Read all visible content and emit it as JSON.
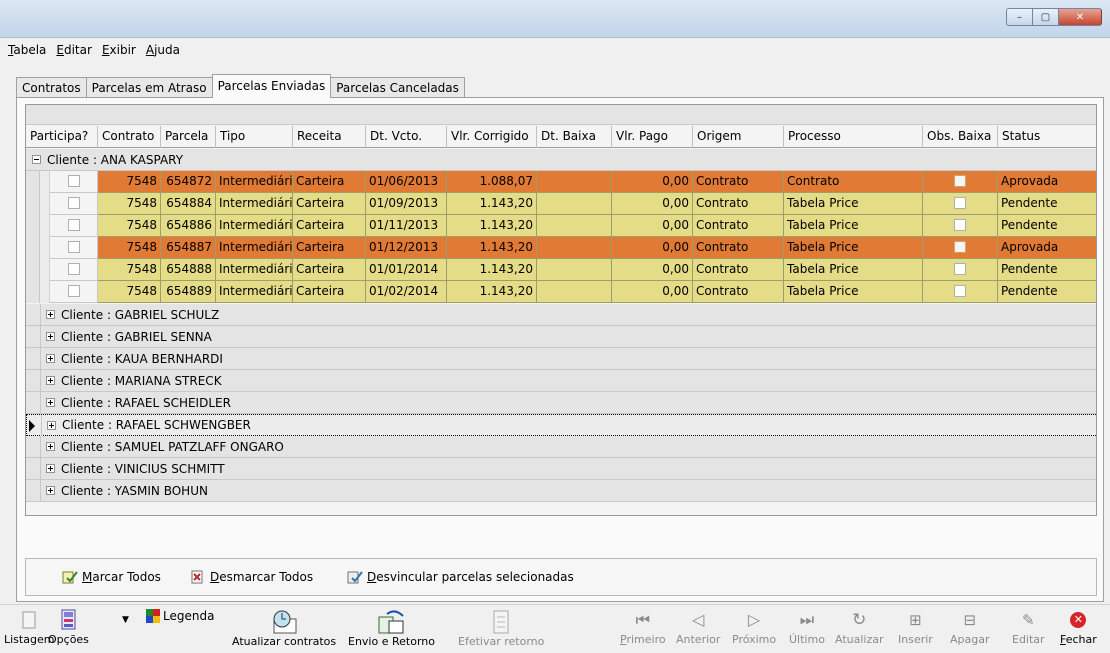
{
  "window": {
    "buttons": {
      "minimize": "–",
      "maximize": "▢",
      "close": "✕"
    }
  },
  "menu": [
    "Tabela",
    "Editar",
    "Exibir",
    "Ajuda"
  ],
  "tabs": [
    "Contratos",
    "Parcelas em Atraso",
    "Parcelas Enviadas",
    "Parcelas Canceladas"
  ],
  "active_tab": "Parcelas Enviadas",
  "grid": {
    "columns": [
      "Participa?",
      "Contrato",
      "Parcela",
      "Tipo",
      "Receita",
      "Dt. Vcto.",
      "Vlr. Corrigido",
      "Dt. Baixa",
      "Vlr. Pago",
      "Origem",
      "Processo",
      "Obs. Baixa",
      "Status"
    ],
    "expanded_group": "Cliente : ANA KASPARY",
    "rows": [
      {
        "contrato": "7548",
        "parcela": "654872",
        "tipo": "Intermediári",
        "receita": "Carteira",
        "dt_vcto": "01/06/2013",
        "vlr_corrigido": "1.088,07",
        "dt_baixa": "",
        "vlr_pago": "0,00",
        "origem": "Contrato",
        "processo": "Contrato",
        "status": "Aprovada"
      },
      {
        "contrato": "7548",
        "parcela": "654884",
        "tipo": "Intermediári",
        "receita": "Carteira",
        "dt_vcto": "01/09/2013",
        "vlr_corrigido": "1.143,20",
        "dt_baixa": "",
        "vlr_pago": "0,00",
        "origem": "Contrato",
        "processo": "Tabela Price",
        "status": "Pendente"
      },
      {
        "contrato": "7548",
        "parcela": "654886",
        "tipo": "Intermediári",
        "receita": "Carteira",
        "dt_vcto": "01/11/2013",
        "vlr_corrigido": "1.143,20",
        "dt_baixa": "",
        "vlr_pago": "0,00",
        "origem": "Contrato",
        "processo": "Tabela Price",
        "status": "Pendente"
      },
      {
        "contrato": "7548",
        "parcela": "654887",
        "tipo": "Intermediári",
        "receita": "Carteira",
        "dt_vcto": "01/12/2013",
        "vlr_corrigido": "1.143,20",
        "dt_baixa": "",
        "vlr_pago": "0,00",
        "origem": "Contrato",
        "processo": "Tabela Price",
        "status": "Aprovada"
      },
      {
        "contrato": "7548",
        "parcela": "654888",
        "tipo": "Intermediári",
        "receita": "Carteira",
        "dt_vcto": "01/01/2014",
        "vlr_corrigido": "1.143,20",
        "dt_baixa": "",
        "vlr_pago": "0,00",
        "origem": "Contrato",
        "processo": "Tabela Price",
        "status": "Pendente"
      },
      {
        "contrato": "7548",
        "parcela": "654889",
        "tipo": "Intermediári",
        "receita": "Carteira",
        "dt_vcto": "01/02/2014",
        "vlr_corrigido": "1.143,20",
        "dt_baixa": "",
        "vlr_pago": "0,00",
        "origem": "Contrato",
        "processo": "Tabela Price",
        "status": "Pendente"
      }
    ],
    "collapsed_groups": [
      "Cliente : GABRIEL SCHULZ",
      "Cliente : GABRIEL SENNA",
      "Cliente : KAUA BERNHARDI",
      "Cliente : MARIANA STRECK",
      "Cliente : RAFAEL SCHEIDLER",
      "Cliente : RAFAEL SCHWENGBER",
      "Cliente : SAMUEL PATZLAFF ONGARO",
      "Cliente : VINICIUS SCHMITT",
      "Cliente : YASMIN BOHUN"
    ],
    "current_group": "Cliente : RAFAEL SCHWENGBER",
    "colors": {
      "aprovada": "#e07a34",
      "pendente": "#e4dc87"
    }
  },
  "actions": {
    "marcar_todos": "Marcar Todos",
    "desmarcar_todos": "Desmarcar Todos",
    "desvincular": "Desvincular parcelas selecionadas"
  },
  "toolbar": {
    "listagem": "Listagem",
    "opcoes": "Opções",
    "legenda": "Legenda",
    "atualizar_contratos": "Atualizar contratos",
    "envio_retorno": "Envio e Retorno",
    "efetivar_retorno": "Efetivar retorno",
    "primeiro": "Primeiro",
    "anterior": "Anterior",
    "proximo": "Próximo",
    "ultimo": "Último",
    "atualizar": "Atualizar",
    "inserir": "Inserir",
    "apagar": "Apagar",
    "editar": "Editar",
    "fechar": "Fechar"
  }
}
